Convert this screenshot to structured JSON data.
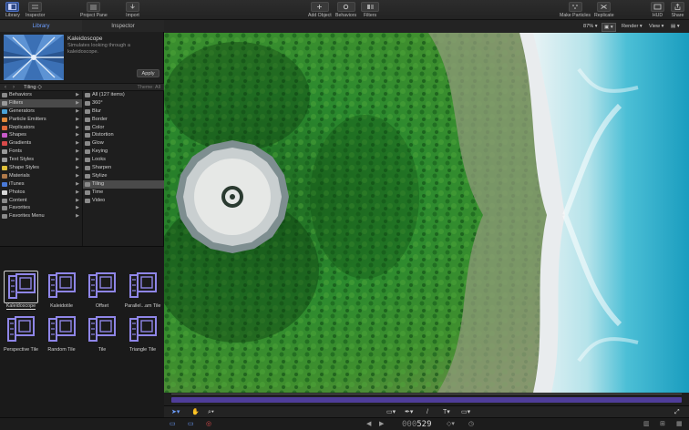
{
  "toolbar": {
    "library": "Library",
    "inspector": "Inspector",
    "project_pane": "Project Pane",
    "import": "Import",
    "add_object": "Add Object",
    "behaviors": "Behaviors",
    "filters": "Filters",
    "make_particles": "Make Particles",
    "replicate": "Replicate",
    "hud": "HUD",
    "share": "Share"
  },
  "panel": {
    "tab_library": "Library",
    "tab_inspector": "Inspector",
    "preview_title": "Kaleidoscope",
    "preview_desc": "Simulates looking through a kaleidoscope.",
    "apply": "Apply",
    "crumb": "Tiling",
    "theme": "Theme: All"
  },
  "categories": [
    {
      "label": "Behaviors",
      "icon": "#8a8a8a"
    },
    {
      "label": "Filters",
      "icon": "#9a9a9a"
    },
    {
      "label": "Generators",
      "icon": "#4aa3d8"
    },
    {
      "label": "Particle Emitters",
      "icon": "#e0893a"
    },
    {
      "label": "Replicators",
      "icon": "#e06a3a"
    },
    {
      "label": "Shapes",
      "icon": "#c85ac8"
    },
    {
      "label": "Gradients",
      "icon": "#d84a4a"
    },
    {
      "label": "Fonts",
      "icon": "#9a9a9a"
    },
    {
      "label": "Text Styles",
      "icon": "#9a9a9a"
    },
    {
      "label": "Shape Styles",
      "icon": "#e0c03a"
    },
    {
      "label": "Materials",
      "icon": "#b07a4a"
    },
    {
      "label": "iTunes",
      "icon": "#4a7ad8"
    },
    {
      "label": "Photos",
      "icon": "#d8d8d8"
    },
    {
      "label": "Content",
      "icon": "#8a8a8a"
    },
    {
      "label": "Favorites",
      "icon": "#8a8a8a"
    },
    {
      "label": "Favorites Menu",
      "icon": "#8a8a8a"
    }
  ],
  "subcategories": [
    "All (127 items)",
    "360°",
    "Blur",
    "Border",
    "Color",
    "Distortion",
    "Glow",
    "Keying",
    "Looks",
    "Sharpen",
    "Stylize",
    "Tiling",
    "Time",
    "Video"
  ],
  "tiles": [
    "Kaleidoscope",
    "Kaleidotile",
    "Offset",
    "Parallel...am Tile",
    "Perspective Tile",
    "Random Tile",
    "Tile",
    "Triangle Tile"
  ],
  "canvas": {
    "zoom": "87%",
    "render": "Render",
    "view": "View"
  },
  "timecode": {
    "prefix": "000",
    "value": "529"
  },
  "colors": {
    "accent": "#6d9eff",
    "timeline": "#4f3d9a",
    "tile_icon": "#8f86e8"
  }
}
